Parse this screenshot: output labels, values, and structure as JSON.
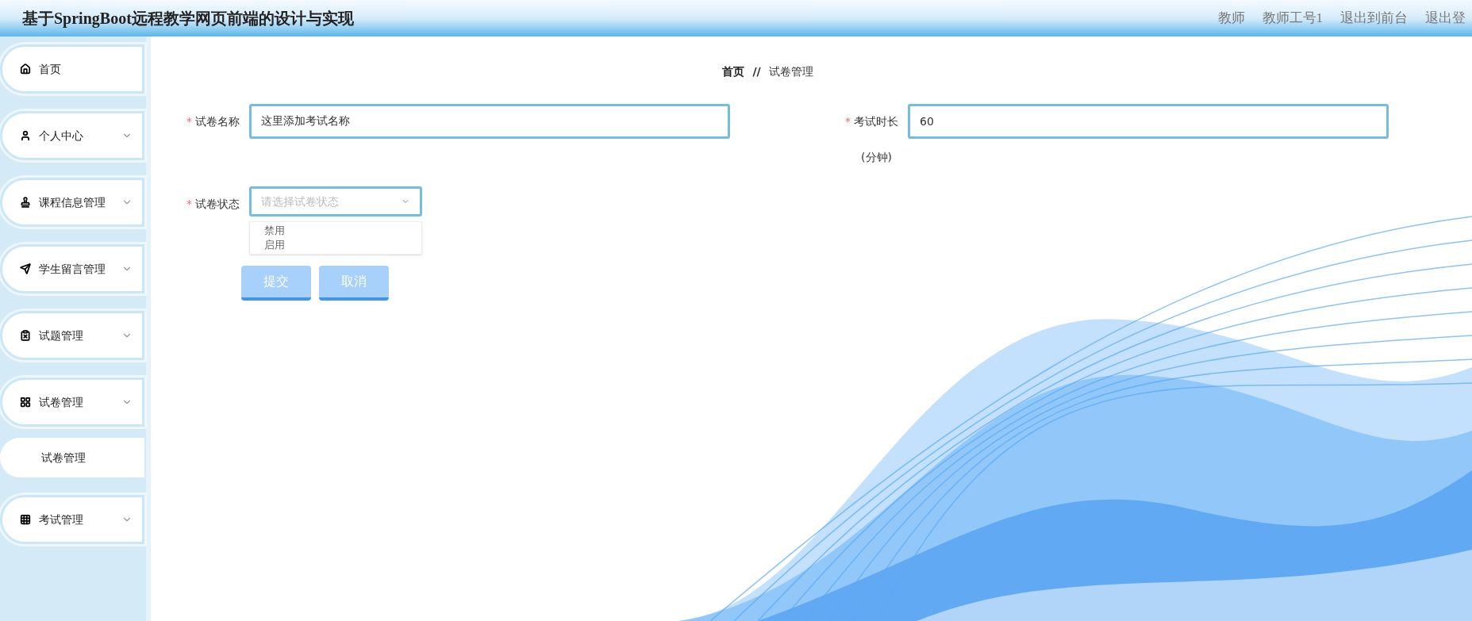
{
  "header": {
    "title": "基于SpringBoot远程教学网页前端的设计与实现",
    "links": [
      "教师",
      "教师工号1",
      "退出到前台",
      "退出登"
    ]
  },
  "sidebar": {
    "items": [
      {
        "label": "首页",
        "expandable": false
      },
      {
        "label": "个人中心",
        "expandable": true
      },
      {
        "label": "课程信息管理",
        "expandable": true
      },
      {
        "label": "学生留言管理",
        "expandable": true
      },
      {
        "label": "试题管理",
        "expandable": true
      },
      {
        "label": "试卷管理",
        "expandable": true,
        "children": [
          {
            "label": "试卷管理"
          }
        ]
      },
      {
        "label": "考试管理",
        "expandable": true
      }
    ]
  },
  "breadcrumb": {
    "items": [
      "首页",
      "试卷管理"
    ],
    "separator": "//"
  },
  "form": {
    "fields": [
      {
        "kind": "input",
        "label": "试卷名称",
        "required_mark": "*",
        "value": "这里添加考试名称"
      },
      {
        "kind": "input",
        "label": "考试时长",
        "required_mark": "*",
        "value": "60",
        "hint": "(分钟)"
      },
      {
        "kind": "select",
        "label": "试卷状态",
        "required_mark": "*",
        "placeholder": "请选择试卷状态",
        "options": [
          "禁用",
          "启用"
        ]
      }
    ],
    "buttons": [
      "提交",
      "取消"
    ]
  }
}
